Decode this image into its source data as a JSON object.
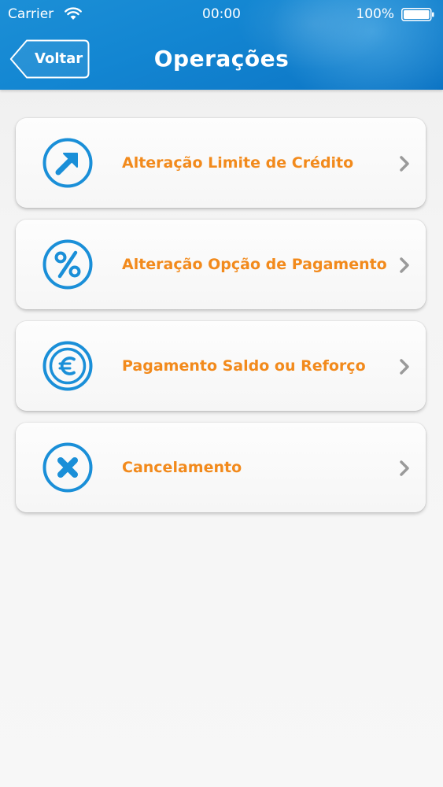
{
  "status_bar": {
    "carrier": "Carrier",
    "time": "00:00",
    "battery": "100%"
  },
  "header": {
    "back_label": "Voltar",
    "title": "Operações"
  },
  "menu": {
    "items": [
      {
        "label": "Alteração Limite de Crédito",
        "icon": "arrow-up-right-icon"
      },
      {
        "label": "Alteração Opção de Pagamento",
        "icon": "percent-icon"
      },
      {
        "label": "Pagamento Saldo ou Reforço",
        "icon": "euro-icon"
      },
      {
        "label": "Cancelamento",
        "icon": "close-icon"
      }
    ]
  },
  "colors": {
    "header_blue": "#1386d2",
    "icon_blue": "#1a8fd8",
    "label_orange": "#f28a1c",
    "chevron_gray": "#9a9a9a"
  }
}
